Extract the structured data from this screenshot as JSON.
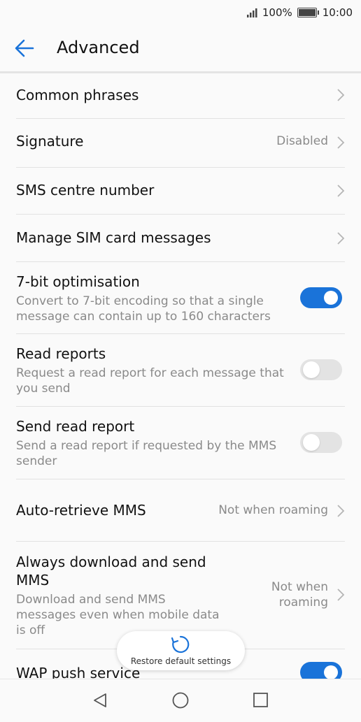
{
  "status_bar": {
    "battery": "100%",
    "time": "10:00"
  },
  "app_bar": {
    "title": "Advanced"
  },
  "settings": {
    "common_phrases": {
      "title": "Common phrases"
    },
    "signature": {
      "title": "Signature",
      "value": "Disabled"
    },
    "sms_centre": {
      "title": "SMS centre number"
    },
    "manage_sim": {
      "title": "Manage SIM card messages"
    },
    "seven_bit": {
      "title": "7-bit optimisation",
      "subtitle_line1": "Convert to 7-bit encoding so that a single",
      "subtitle_line2": "message can contain up to 160 characters",
      "enabled": true
    },
    "read_reports": {
      "title": "Read reports",
      "subtitle_line1": "Request a read report for each message that",
      "subtitle_line2": "you send",
      "enabled": false
    },
    "send_read_report": {
      "title": "Send read report",
      "subtitle_line1": "Send a read report if requested by the MMS",
      "subtitle_line2": "sender",
      "enabled": false
    },
    "auto_retrieve": {
      "title": "Auto-retrieve MMS",
      "value": "Not when roaming"
    },
    "always_download": {
      "title_line1": "Always download and send",
      "title_line2": "MMS",
      "subtitle_line1": "Download and send MMS",
      "subtitle_line2": "messages even when mobile data",
      "subtitle_line3": "is off",
      "value_line1": "Not when",
      "value_line2": "roaming"
    },
    "wap_push": {
      "title": "WAP push service",
      "enabled": true
    }
  },
  "restore_button": {
    "label": "Restore default settings"
  },
  "colors": {
    "accent": "#1a73d9",
    "toggle_off": "#e3e3e3",
    "secondary_text": "#8a8a8a"
  },
  "icons": {
    "back": "arrow-left-icon",
    "chevron": "chevron-right-icon",
    "restore": "refresh-icon",
    "nav_back": "triangle-back-icon",
    "nav_home": "circle-home-icon",
    "nav_recent": "square-recents-icon"
  }
}
